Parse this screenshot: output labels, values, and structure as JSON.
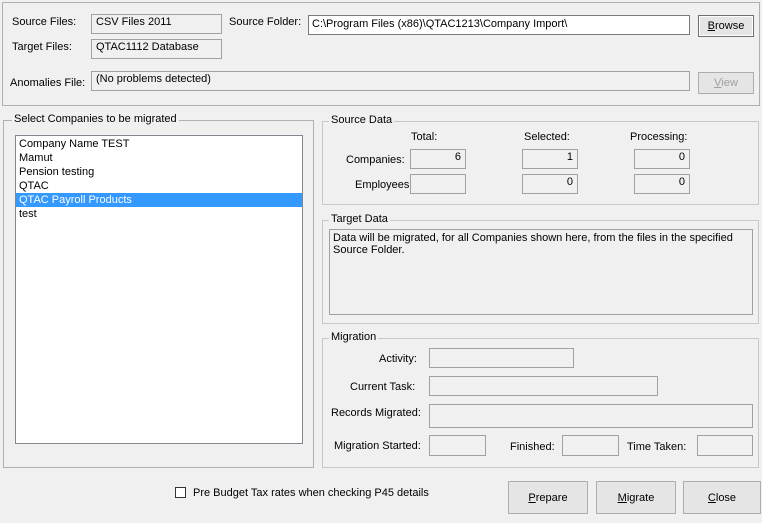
{
  "files": {
    "source_files_label": "Source Files:",
    "source_files_value": "CSV Files 2011",
    "target_files_label": "Target Files:",
    "target_files_value": "QTAC1112 Database",
    "source_folder_label": "Source Folder:",
    "source_folder_value": "C:\\Program Files (x86)\\QTAC1213\\Company Import\\",
    "browse_label_u": "B",
    "browse_label_rest": "rowse",
    "anomalies_label": "Anomalies File:",
    "anomalies_value": "(No problems detected)",
    "view_label_u": "V",
    "view_label_rest": "iew"
  },
  "companies": {
    "legend": "Select Companies to be migrated",
    "items": [
      {
        "label": "Company Name TEST",
        "selected": false
      },
      {
        "label": "Mamut",
        "selected": false
      },
      {
        "label": "Pension testing",
        "selected": false
      },
      {
        "label": "QTAC",
        "selected": false
      },
      {
        "label": "QTAC Payroll Products",
        "selected": true
      },
      {
        "label": "test",
        "selected": false
      }
    ]
  },
  "source_data": {
    "legend": "Source Data",
    "col_total": "Total:",
    "col_selected": "Selected:",
    "col_processing": "Processing:",
    "companies_label": "Companies:",
    "employees_label": "Employees:",
    "companies_total": "6",
    "companies_selected": "1",
    "companies_processing": "0",
    "employees_total": "",
    "employees_selected": "0",
    "employees_processing": "0"
  },
  "target_data": {
    "legend": "Target Data",
    "text": "Data will be migrated, for all Companies shown here, from the files in the specified Source Folder."
  },
  "migration": {
    "legend": "Migration",
    "activity_label": "Activity:",
    "current_task_label": "Current Task:",
    "records_migrated_label": "Records Migrated:",
    "migration_started_label": "Migration Started:",
    "finished_label": "Finished:",
    "time_taken_label": "Time Taken:"
  },
  "footer": {
    "checkbox_label": "Pre Budget Tax rates when checking P45 details",
    "checkbox_checked": false,
    "prepare_u": "P",
    "prepare_rest": "repare",
    "migrate_u": "M",
    "migrate_rest": "igrate",
    "close_u": "C",
    "close_rest": "lose"
  }
}
